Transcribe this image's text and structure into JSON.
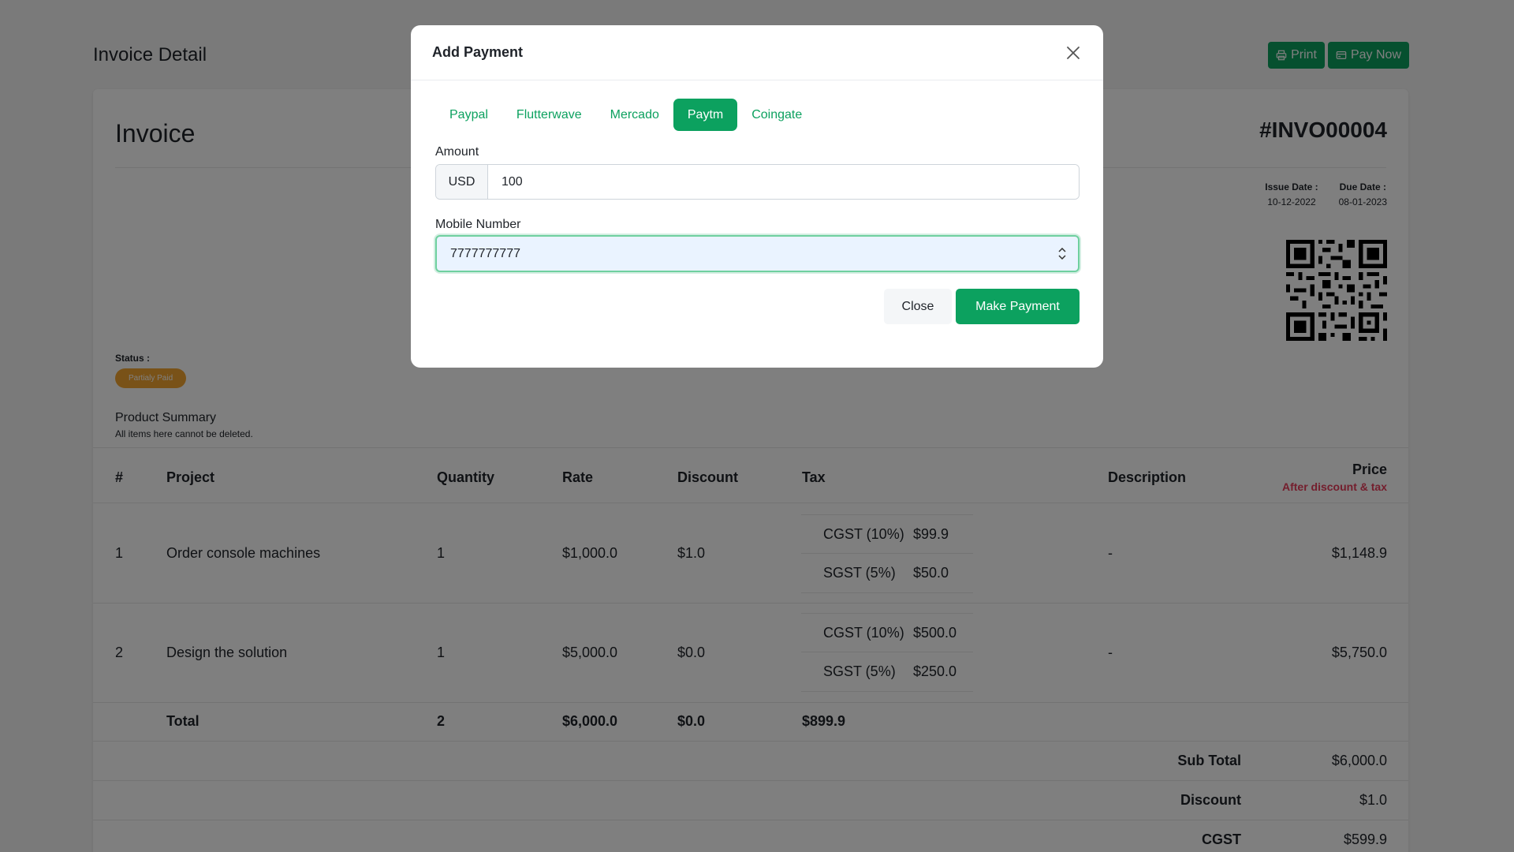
{
  "page": {
    "title": "Invoice Detail",
    "print_label": "Print",
    "pay_now_label": "Pay Now"
  },
  "invoice": {
    "heading": "Invoice",
    "number": "#INVO00004",
    "issue_date_label": "Issue Date :",
    "issue_date": "10-12-2022",
    "due_date_label": "Due Date :",
    "due_date": "08-01-2023",
    "status_label": "Status :",
    "status": "Partialy Paid",
    "summary_title": "Product Summary",
    "summary_subtitle": "All items here cannot be deleted."
  },
  "table": {
    "headers": {
      "num": "#",
      "project": "Project",
      "quantity": "Quantity",
      "rate": "Rate",
      "discount": "Discount",
      "tax": "Tax",
      "description": "Description",
      "price": "Price",
      "price_note": "After discount & tax"
    },
    "rows": [
      {
        "num": "1",
        "project": "Order console machines",
        "quantity": "1",
        "rate": "$1,000.0",
        "discount": "$1.0",
        "taxes": [
          {
            "name": "CGST (10%)",
            "value": "$99.9"
          },
          {
            "name": "SGST (5%)",
            "value": "$50.0"
          }
        ],
        "description": "-",
        "price": "$1,148.9"
      },
      {
        "num": "2",
        "project": "Design the solution",
        "quantity": "1",
        "rate": "$5,000.0",
        "discount": "$0.0",
        "taxes": [
          {
            "name": "CGST (10%)",
            "value": "$500.0"
          },
          {
            "name": "SGST (5%)",
            "value": "$250.0"
          }
        ],
        "description": "-",
        "price": "$5,750.0"
      }
    ],
    "total": {
      "label": "Total",
      "quantity": "2",
      "rate": "$6,000.0",
      "discount": "$0.0",
      "tax": "$899.9"
    },
    "summary": [
      {
        "label": "Sub Total",
        "value": "$6,000.0"
      },
      {
        "label": "Discount",
        "value": "$1.0"
      },
      {
        "label": "CGST",
        "value": "$599.9"
      }
    ]
  },
  "modal": {
    "title": "Add Payment",
    "tabs": [
      "Paypal",
      "Flutterwave",
      "Mercado",
      "Paytm",
      "Coingate"
    ],
    "active_tab": "Paytm",
    "amount_label": "Amount",
    "currency": "USD",
    "amount_value": "100",
    "mobile_label": "Mobile Number",
    "mobile_value": "7777777777",
    "close_label": "Close",
    "submit_label": "Make Payment"
  },
  "colors": {
    "accent": "#0ca15f",
    "status_badge": "#f3a531",
    "price_note": "#e83c5a"
  }
}
